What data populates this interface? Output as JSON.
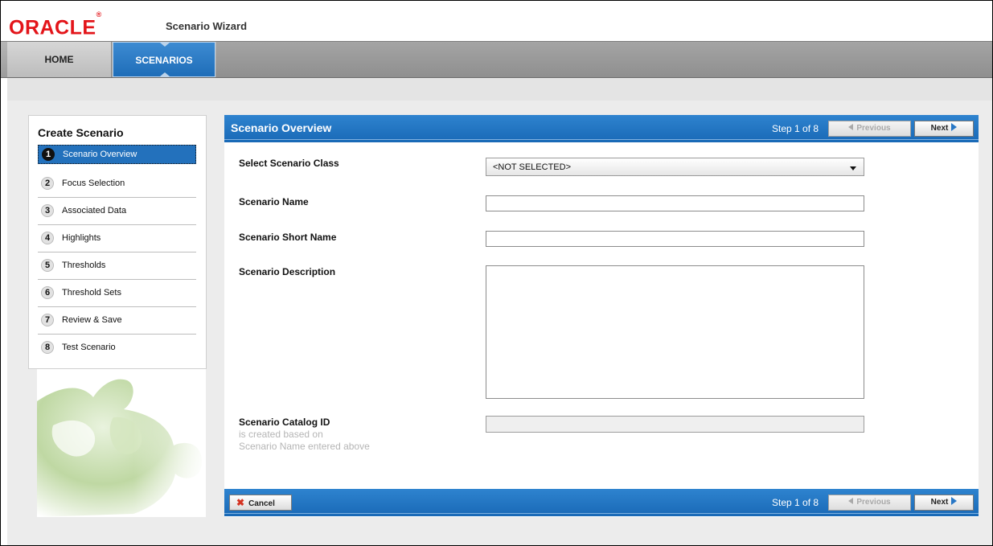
{
  "header": {
    "logo_text": "ORACLE",
    "logo_mark": "®",
    "app_title": "Scenario Wizard"
  },
  "nav": {
    "tabs": [
      {
        "label": "HOME",
        "active": false
      },
      {
        "label": "SCENARIOS",
        "active": true
      }
    ]
  },
  "steps_panel": {
    "title": "Create Scenario",
    "steps": [
      {
        "num": "1",
        "label": "Scenario Overview",
        "active": true
      },
      {
        "num": "2",
        "label": "Focus Selection",
        "active": false
      },
      {
        "num": "3",
        "label": "Associated Data",
        "active": false
      },
      {
        "num": "4",
        "label": "Highlights",
        "active": false
      },
      {
        "num": "5",
        "label": "Thresholds",
        "active": false
      },
      {
        "num": "6",
        "label": "Threshold Sets",
        "active": false
      },
      {
        "num": "7",
        "label": "Review & Save",
        "active": false
      },
      {
        "num": "8",
        "label": "Test Scenario",
        "active": false
      }
    ]
  },
  "main": {
    "section_title": "Scenario Overview",
    "step_indicator": "Step 1 of 8",
    "previous_label": "Previous",
    "next_label": "Next",
    "cancel_label": "Cancel",
    "fields": {
      "scenario_class": {
        "label": "Select Scenario Class",
        "value": "<NOT SELECTED>"
      },
      "scenario_name": {
        "label": "Scenario Name",
        "value": ""
      },
      "scenario_short_name": {
        "label": "Scenario Short Name",
        "value": ""
      },
      "scenario_description": {
        "label": "Scenario Description",
        "value": ""
      },
      "scenario_catalog_id": {
        "label": "Scenario Catalog ID",
        "hint_line1": "is created based on",
        "hint_line2": "Scenario Name entered above",
        "value": ""
      }
    }
  },
  "colors": {
    "oracle_red": "#e3151a",
    "accent_blue": "#1e6db8",
    "nav_gray": "#9c9c9c",
    "cancel_x": "#d43322"
  },
  "icons": {
    "cancel": "x-icon",
    "previous": "triangle-left-icon",
    "next": "triangle-right-icon",
    "dropdown": "chevron-down-icon",
    "decoration": "puzzle-piece-icon"
  }
}
